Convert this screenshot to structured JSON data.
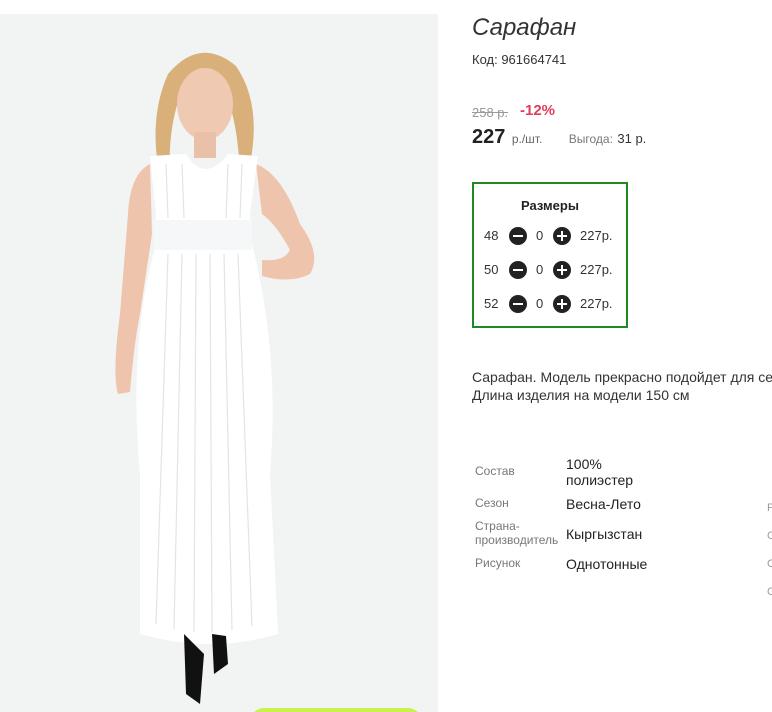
{
  "product": {
    "title": "Сарафан",
    "code": "Код: 961664741",
    "old_price": "258 р.",
    "discount": "-12%",
    "price": "227",
    "price_unit": "р./шт.",
    "benefit_label": "Выгода:",
    "benefit_value": "31 р."
  },
  "sizes": {
    "title": "Размеры",
    "rows": [
      {
        "size": "48",
        "qty": "0",
        "price": "227р."
      },
      {
        "size": "50",
        "qty": "0",
        "price": "227р."
      },
      {
        "size": "52",
        "qty": "0",
        "price": "227р."
      }
    ]
  },
  "description": {
    "line1": "Сарафан. Модель прекрасно подойдет для се",
    "line2": "Длина изделия на модели 150 см"
  },
  "attributes": [
    {
      "label": "Состав",
      "value_line1": "100%",
      "value_line2": "полиэстер"
    },
    {
      "label": "Сезон",
      "value": "Весна-Лето"
    },
    {
      "label_line1": "Страна-",
      "label_line2": "производитель",
      "value": "Кыргызстан"
    },
    {
      "label": "Рисунок",
      "value": "Однотонные"
    }
  ],
  "edge_letters": [
    "Р",
    "С",
    "С",
    "С"
  ],
  "colors": {
    "discount": "#e23c5a",
    "sizes_border": "#1f8a1f",
    "photo_bg": "#f2f3f3",
    "dress": "#ffffff",
    "hair": "#d9b07a",
    "skin": "#f0c9b3",
    "accent_button": "#c9f24a"
  }
}
